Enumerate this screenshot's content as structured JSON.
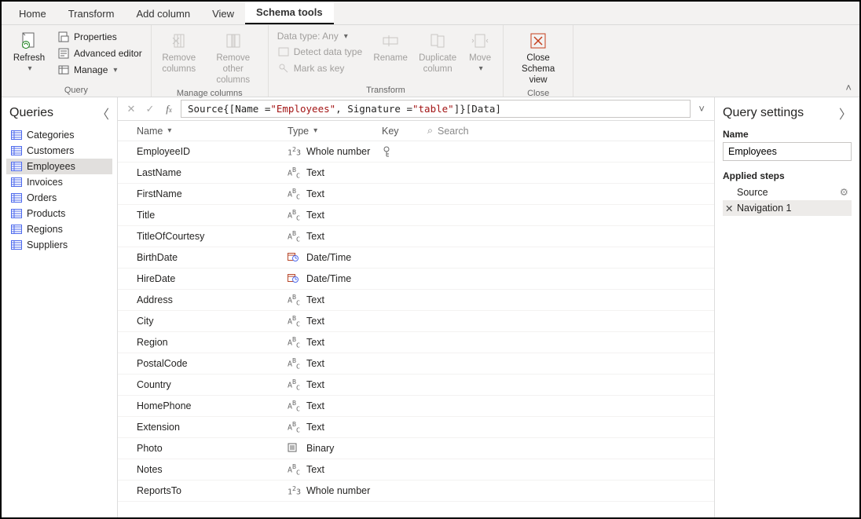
{
  "tabs": {
    "home": "Home",
    "transform": "Transform",
    "addcolumn": "Add column",
    "view": "View",
    "schematools": "Schema tools"
  },
  "ribbon": {
    "query": {
      "label": "Query",
      "refresh": "Refresh",
      "properties": "Properties",
      "advanced_editor": "Advanced editor",
      "manage": "Manage"
    },
    "manage_columns": {
      "label": "Manage columns",
      "remove_columns": "Remove columns",
      "remove_other": "Remove other columns"
    },
    "transform": {
      "label": "Transform",
      "data_type": "Data type: Any",
      "detect": "Detect data type",
      "mark_key": "Mark as key",
      "rename": "Rename",
      "duplicate": "Duplicate column",
      "move": "Move"
    },
    "close": {
      "label": "Close",
      "close_schema": "Close Schema view"
    }
  },
  "queries_pane": {
    "title": "Queries",
    "items": [
      "Categories",
      "Customers",
      "Employees",
      "Invoices",
      "Orders",
      "Products",
      "Regions",
      "Suppliers"
    ]
  },
  "formula": {
    "pre": "Source{[Name = ",
    "s1": "\"Employees\"",
    "mid": ", Signature = ",
    "s2": "\"table\"",
    "post": "]}[Data]"
  },
  "schema_header": {
    "name": "Name",
    "type": "Type",
    "key": "Key",
    "search": "Search"
  },
  "schema_rows": [
    {
      "name": "EmployeeID",
      "typeIcon": "num",
      "type": "Whole number",
      "key": true
    },
    {
      "name": "LastName",
      "typeIcon": "abc",
      "type": "Text"
    },
    {
      "name": "FirstName",
      "typeIcon": "abc",
      "type": "Text"
    },
    {
      "name": "Title",
      "typeIcon": "abc",
      "type": "Text"
    },
    {
      "name": "TitleOfCourtesy",
      "typeIcon": "abc",
      "type": "Text"
    },
    {
      "name": "BirthDate",
      "typeIcon": "dt",
      "type": "Date/Time"
    },
    {
      "name": "HireDate",
      "typeIcon": "dt",
      "type": "Date/Time"
    },
    {
      "name": "Address",
      "typeIcon": "abc",
      "type": "Text"
    },
    {
      "name": "City",
      "typeIcon": "abc",
      "type": "Text"
    },
    {
      "name": "Region",
      "typeIcon": "abc",
      "type": "Text"
    },
    {
      "name": "PostalCode",
      "typeIcon": "abc",
      "type": "Text"
    },
    {
      "name": "Country",
      "typeIcon": "abc",
      "type": "Text"
    },
    {
      "name": "HomePhone",
      "typeIcon": "abc",
      "type": "Text"
    },
    {
      "name": "Extension",
      "typeIcon": "abc",
      "type": "Text"
    },
    {
      "name": "Photo",
      "typeIcon": "bin",
      "type": "Binary"
    },
    {
      "name": "Notes",
      "typeIcon": "abc",
      "type": "Text"
    },
    {
      "name": "ReportsTo",
      "typeIcon": "num",
      "type": "Whole number"
    }
  ],
  "settings": {
    "title": "Query settings",
    "name_label": "Name",
    "name_value": "Employees",
    "applied_label": "Applied steps",
    "steps": [
      {
        "label": "Source",
        "gear": true,
        "selected": false,
        "x": false
      },
      {
        "label": "Navigation 1",
        "gear": false,
        "selected": true,
        "x": true
      }
    ]
  }
}
